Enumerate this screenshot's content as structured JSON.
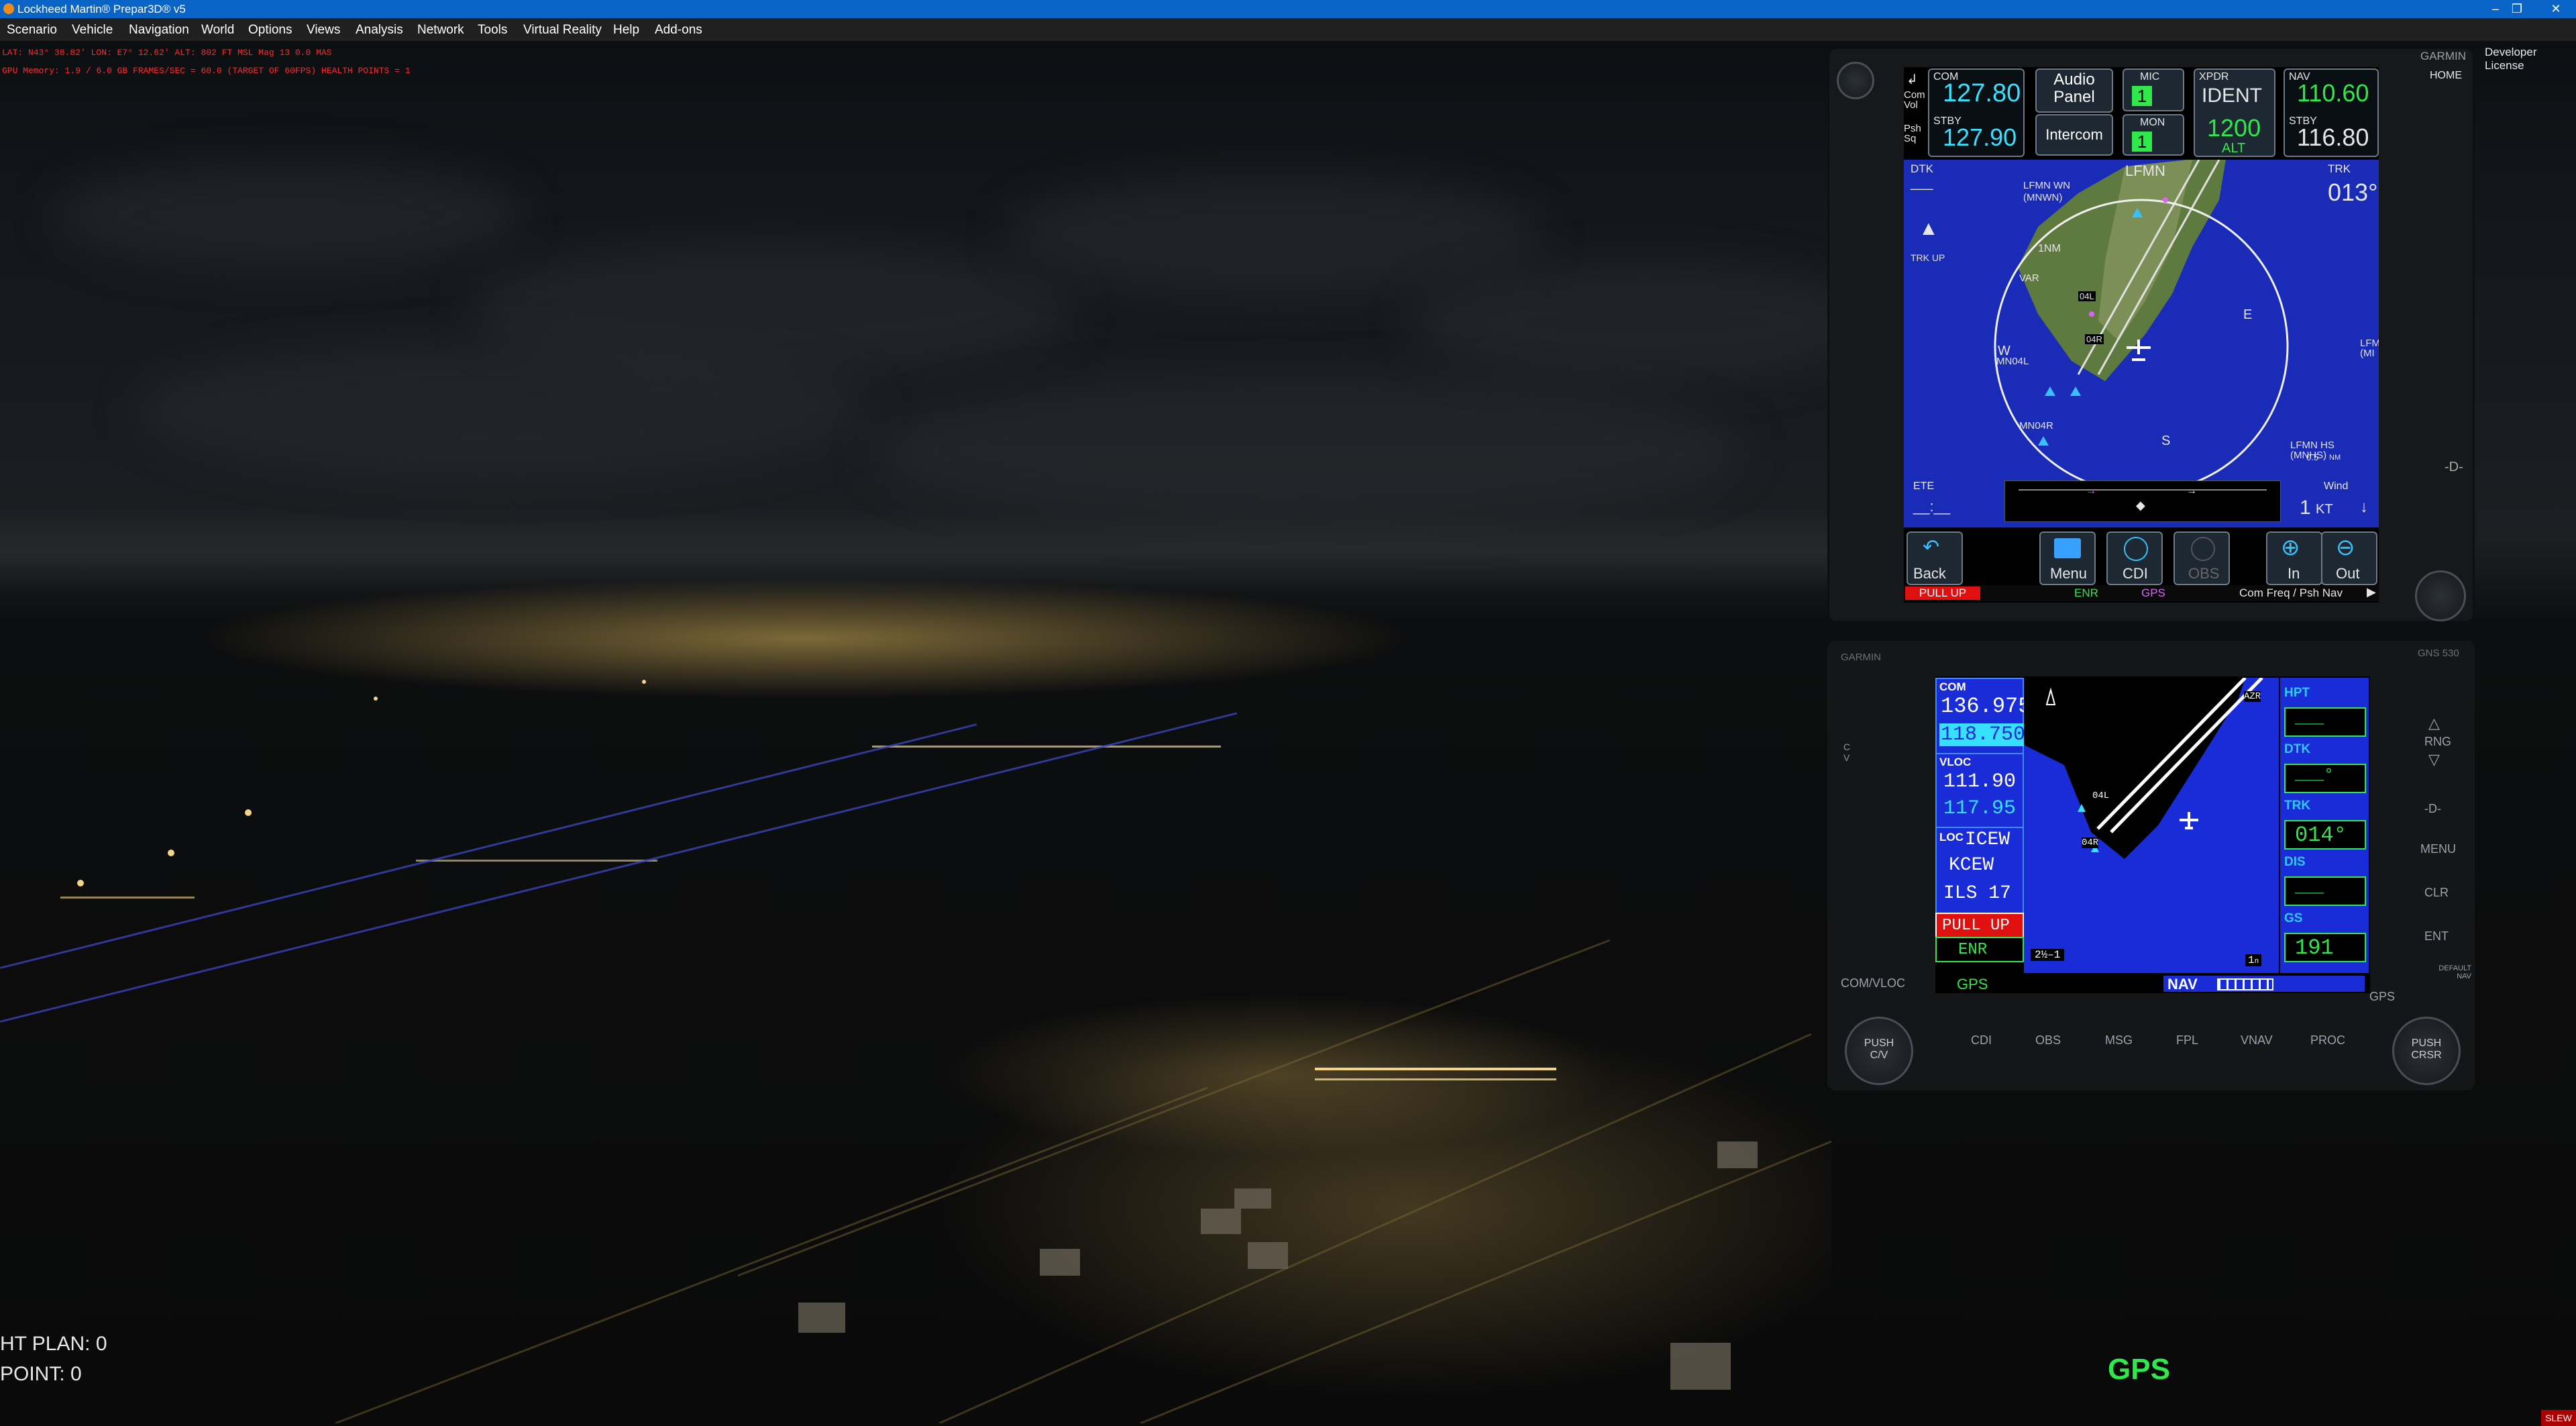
{
  "window": {
    "title": "Lockheed Martin® Prepar3D® v5"
  },
  "menu": {
    "items": [
      "Scenario",
      "Vehicle",
      "Navigation",
      "World",
      "Options",
      "Views",
      "Analysis",
      "Network",
      "Tools",
      "Virtual Reality",
      "Help",
      "Add-ons"
    ]
  },
  "overlay": {
    "line1": "LAT: N43° 38.82'  LON: E7° 12.62'  ALT: 802 FT  MSL   Mag 13  0.0 MAS",
    "line2": "GPU Memory: 1.9 / 6.0 GB  FRAMES/SEC = 60.0   (TARGET OF 60FPS)   HEALTH POINTS = 1",
    "flight_plan": "HT PLAN: 0",
    "waypoint": "POINT: 0",
    "license": "Developer License",
    "gps_label": "GPS",
    "slew": "SLEW"
  },
  "gtn": {
    "brand": "GARMIN",
    "home": "HOME",
    "com_label": "COM",
    "com_active": "127.80",
    "com_stby_label": "STBY",
    "com_stby": "127.90",
    "com_vol": "Com\nVol",
    "psh_sq": "Psh\nSq",
    "audio_panel": "Audio\nPanel",
    "intercom": "Intercom",
    "mic_label": "MIC",
    "mic_val": "1",
    "mon_label": "MON",
    "mon_val": "1",
    "xpdr_label": "XPDR",
    "xpdr_mode": "IDENT",
    "xpdr_code": "1200",
    "xpdr_alt": "ALT",
    "nav_label": "NAV",
    "nav_active": "110.60",
    "nav_stby_label": "STBY",
    "nav_stby": "116.80",
    "dtk_label": "DTK",
    "trk_label": "TRK",
    "trk_val": "013°",
    "trk_up": "TRK UP",
    "ete_label": "ETE",
    "ete_val": "__:__",
    "wind_label": "Wind",
    "wind_val": "1",
    "wind_unit": "KT",
    "map_labels": {
      "lfmn": "LFMN",
      "lfmn_wn": "LFMN WN\n(MNWN)",
      "var": "VAR",
      "w": "W",
      "s": "S",
      "e": "E",
      "mn04l": "MN04L",
      "mn04r": "MN04R",
      "lfmn_hs": "LFMN HS\n(MNHS)",
      "range": "0.5",
      "range_unit": "NM",
      "lf_edge": "LFM\n(MI",
      "r04l": "04L",
      "r04r": "04R",
      "nm1": "1NM"
    },
    "buttons": [
      "Back",
      "Menu",
      "CDI",
      "OBS",
      "In",
      "Out"
    ],
    "status": {
      "pull_up": "PULL UP",
      "enr": "ENR",
      "gps": "GPS",
      "hint": "Com Freq / Psh Nav"
    }
  },
  "gns": {
    "brand": "GARMIN",
    "model": "GNS 530",
    "com_label": "COM",
    "com_active": "136.975",
    "com_stby": "118.750",
    "vloc_label": "VLOC",
    "vloc_active": "111.90",
    "vloc_stby": "117.95",
    "loc_label": "LOC",
    "loc_id": "ICEW",
    "loc_apt": "KCEW",
    "loc_name": "ILS 17",
    "pull_up": "PULL UP",
    "enr": "ENR",
    "gps": "GPS",
    "nav": "NAV",
    "range_val": "2½",
    "range_left": "2",
    "fields": [
      {
        "label": "HPT",
        "value": "___"
      },
      {
        "label": "DTK",
        "value": "___°"
      },
      {
        "label": "TRK",
        "value": "014°"
      },
      {
        "label": "DIS",
        "value": "___"
      },
      {
        "label": "GS",
        "value": "191"
      }
    ],
    "map": {
      "azr": "AZR",
      "r04l": "04L",
      "r04r": "04R"
    },
    "left_labels": [
      "COM/VLOC",
      "PUSH\nC/V"
    ],
    "right_labels": [
      "RNG",
      "MENU",
      "CLR",
      "ENT",
      "GPS",
      "PUSH\nCRSR",
      "DEFAULT\nNAV"
    ],
    "softkeys": [
      "CDI",
      "OBS",
      "MSG",
      "FPL",
      "VNAV",
      "PROC"
    ]
  }
}
